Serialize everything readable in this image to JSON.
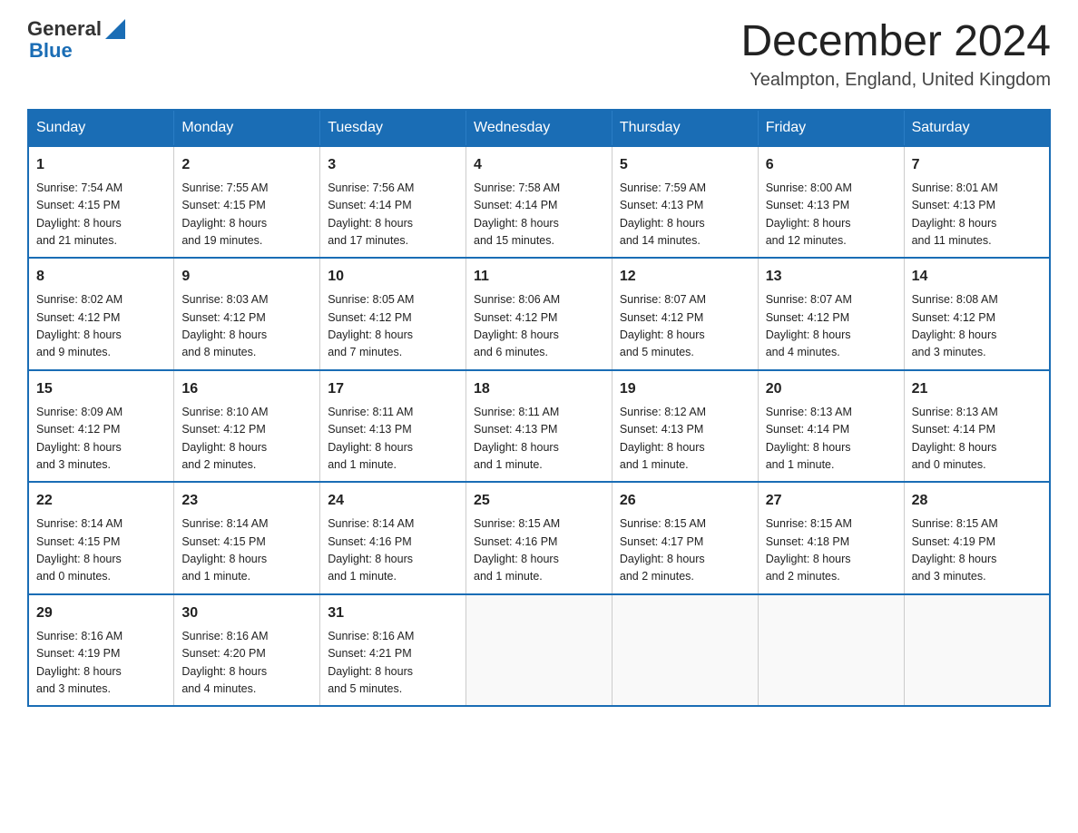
{
  "logo": {
    "text1": "General",
    "text2": "Blue"
  },
  "title": "December 2024",
  "location": "Yealmpton, England, United Kingdom",
  "headers": [
    "Sunday",
    "Monday",
    "Tuesday",
    "Wednesday",
    "Thursday",
    "Friday",
    "Saturday"
  ],
  "weeks": [
    [
      {
        "day": "1",
        "sunrise": "7:54 AM",
        "sunset": "4:15 PM",
        "daylight": "8 hours and 21 minutes."
      },
      {
        "day": "2",
        "sunrise": "7:55 AM",
        "sunset": "4:15 PM",
        "daylight": "8 hours and 19 minutes."
      },
      {
        "day": "3",
        "sunrise": "7:56 AM",
        "sunset": "4:14 PM",
        "daylight": "8 hours and 17 minutes."
      },
      {
        "day": "4",
        "sunrise": "7:58 AM",
        "sunset": "4:14 PM",
        "daylight": "8 hours and 15 minutes."
      },
      {
        "day": "5",
        "sunrise": "7:59 AM",
        "sunset": "4:13 PM",
        "daylight": "8 hours and 14 minutes."
      },
      {
        "day": "6",
        "sunrise": "8:00 AM",
        "sunset": "4:13 PM",
        "daylight": "8 hours and 12 minutes."
      },
      {
        "day": "7",
        "sunrise": "8:01 AM",
        "sunset": "4:13 PM",
        "daylight": "8 hours and 11 minutes."
      }
    ],
    [
      {
        "day": "8",
        "sunrise": "8:02 AM",
        "sunset": "4:12 PM",
        "daylight": "8 hours and 9 minutes."
      },
      {
        "day": "9",
        "sunrise": "8:03 AM",
        "sunset": "4:12 PM",
        "daylight": "8 hours and 8 minutes."
      },
      {
        "day": "10",
        "sunrise": "8:05 AM",
        "sunset": "4:12 PM",
        "daylight": "8 hours and 7 minutes."
      },
      {
        "day": "11",
        "sunrise": "8:06 AM",
        "sunset": "4:12 PM",
        "daylight": "8 hours and 6 minutes."
      },
      {
        "day": "12",
        "sunrise": "8:07 AM",
        "sunset": "4:12 PM",
        "daylight": "8 hours and 5 minutes."
      },
      {
        "day": "13",
        "sunrise": "8:07 AM",
        "sunset": "4:12 PM",
        "daylight": "8 hours and 4 minutes."
      },
      {
        "day": "14",
        "sunrise": "8:08 AM",
        "sunset": "4:12 PM",
        "daylight": "8 hours and 3 minutes."
      }
    ],
    [
      {
        "day": "15",
        "sunrise": "8:09 AM",
        "sunset": "4:12 PM",
        "daylight": "8 hours and 3 minutes."
      },
      {
        "day": "16",
        "sunrise": "8:10 AM",
        "sunset": "4:12 PM",
        "daylight": "8 hours and 2 minutes."
      },
      {
        "day": "17",
        "sunrise": "8:11 AM",
        "sunset": "4:13 PM",
        "daylight": "8 hours and 1 minute."
      },
      {
        "day": "18",
        "sunrise": "8:11 AM",
        "sunset": "4:13 PM",
        "daylight": "8 hours and 1 minute."
      },
      {
        "day": "19",
        "sunrise": "8:12 AM",
        "sunset": "4:13 PM",
        "daylight": "8 hours and 1 minute."
      },
      {
        "day": "20",
        "sunrise": "8:13 AM",
        "sunset": "4:14 PM",
        "daylight": "8 hours and 1 minute."
      },
      {
        "day": "21",
        "sunrise": "8:13 AM",
        "sunset": "4:14 PM",
        "daylight": "8 hours and 0 minutes."
      }
    ],
    [
      {
        "day": "22",
        "sunrise": "8:14 AM",
        "sunset": "4:15 PM",
        "daylight": "8 hours and 0 minutes."
      },
      {
        "day": "23",
        "sunrise": "8:14 AM",
        "sunset": "4:15 PM",
        "daylight": "8 hours and 1 minute."
      },
      {
        "day": "24",
        "sunrise": "8:14 AM",
        "sunset": "4:16 PM",
        "daylight": "8 hours and 1 minute."
      },
      {
        "day": "25",
        "sunrise": "8:15 AM",
        "sunset": "4:16 PM",
        "daylight": "8 hours and 1 minute."
      },
      {
        "day": "26",
        "sunrise": "8:15 AM",
        "sunset": "4:17 PM",
        "daylight": "8 hours and 2 minutes."
      },
      {
        "day": "27",
        "sunrise": "8:15 AM",
        "sunset": "4:18 PM",
        "daylight": "8 hours and 2 minutes."
      },
      {
        "day": "28",
        "sunrise": "8:15 AM",
        "sunset": "4:19 PM",
        "daylight": "8 hours and 3 minutes."
      }
    ],
    [
      {
        "day": "29",
        "sunrise": "8:16 AM",
        "sunset": "4:19 PM",
        "daylight": "8 hours and 3 minutes."
      },
      {
        "day": "30",
        "sunrise": "8:16 AM",
        "sunset": "4:20 PM",
        "daylight": "8 hours and 4 minutes."
      },
      {
        "day": "31",
        "sunrise": "8:16 AM",
        "sunset": "4:21 PM",
        "daylight": "8 hours and 5 minutes."
      },
      null,
      null,
      null,
      null
    ]
  ],
  "labels": {
    "sunrise_prefix": "Sunrise: ",
    "sunset_prefix": "Sunset: ",
    "daylight_prefix": "Daylight: "
  }
}
